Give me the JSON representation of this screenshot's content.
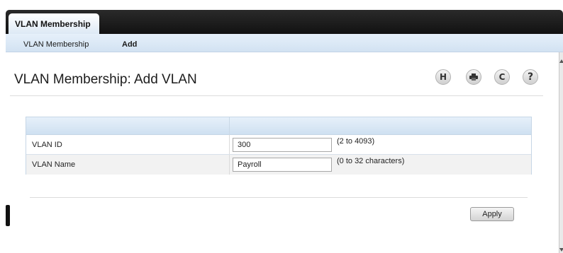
{
  "main_tab": {
    "label": "VLAN Membership"
  },
  "subnav": {
    "items": [
      {
        "label": "VLAN Membership"
      },
      {
        "label": "Add"
      }
    ]
  },
  "page": {
    "title": "VLAN Membership: Add VLAN"
  },
  "toolbar": {
    "save_icon": "H",
    "print_icon": "print-icon",
    "refresh_icon": "C",
    "help_icon": "?"
  },
  "form": {
    "rows": [
      {
        "label": "VLAN ID",
        "value": "300",
        "hint": "(2 to 4093)"
      },
      {
        "label": "VLAN Name",
        "value": "Payroll",
        "hint": "(0 to 32 characters)"
      }
    ]
  },
  "actions": {
    "apply_label": "Apply"
  }
}
